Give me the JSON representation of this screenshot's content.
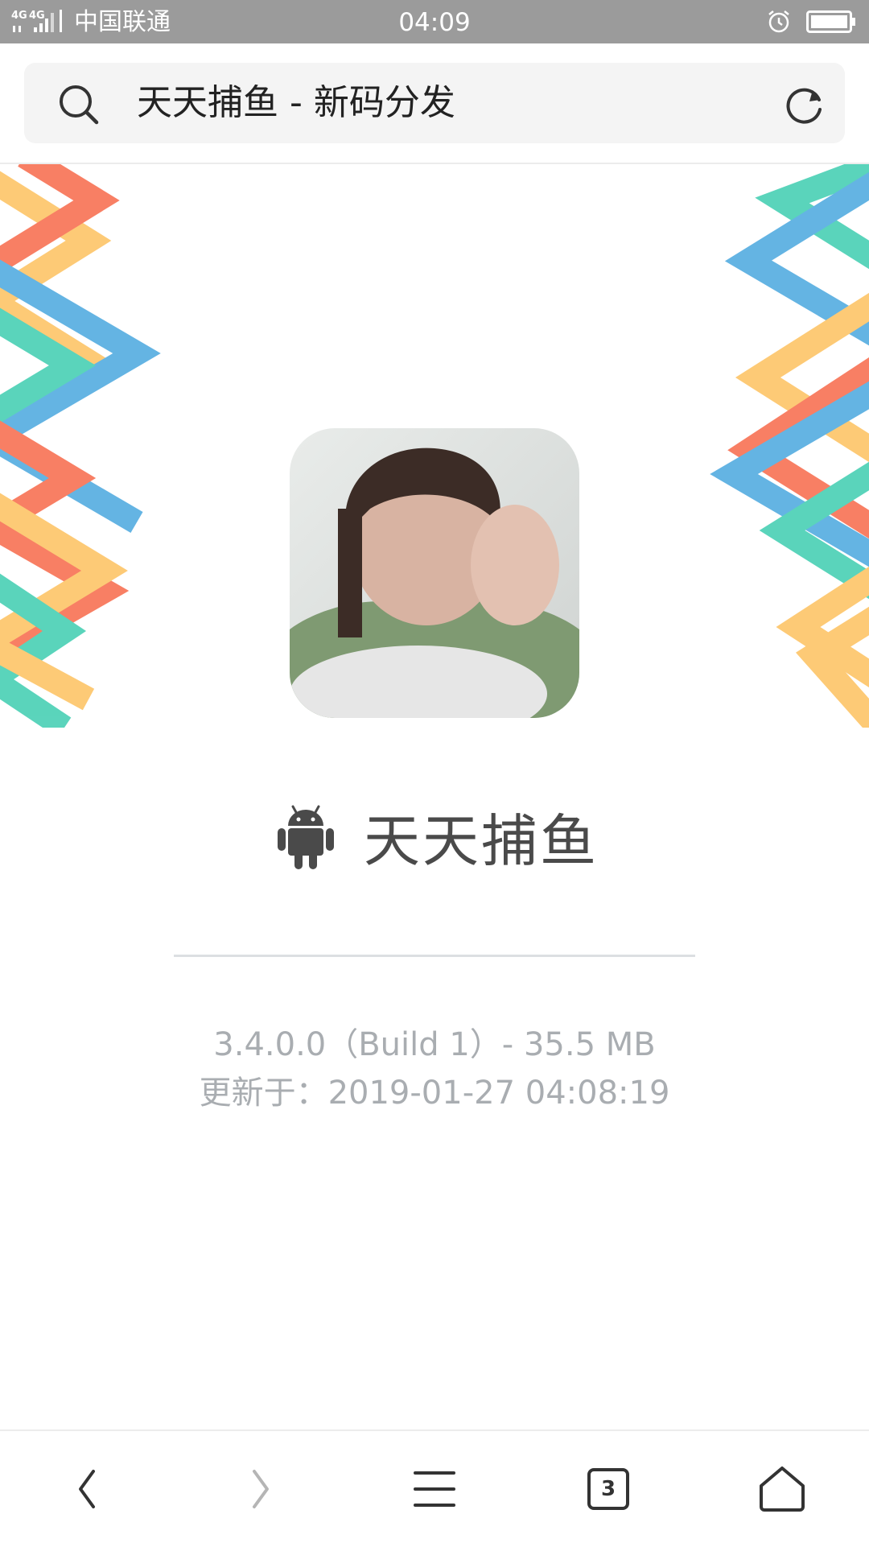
{
  "status_bar": {
    "network": "4G 4G",
    "carrier": "中国联通",
    "time": "04:09"
  },
  "address_bar": {
    "page_title": "天天捕鱼 - 新码分发"
  },
  "app": {
    "name": "天天捕鱼",
    "version_info": "3.4.0.0（Build 1）- 35.5 MB",
    "updated_info": "更新于：2019-01-27 04:08:19"
  },
  "bottom_bar": {
    "tab_count": "3"
  },
  "icons": [
    "search-icon",
    "refresh-icon",
    "android-icon",
    "back-icon",
    "forward-icon",
    "menu-icon",
    "tabs-icon",
    "home-icon",
    "alarm-icon",
    "battery-icon",
    "signal-icon"
  ],
  "colors": {
    "status_bar": "#9b9b9b",
    "pattern_red": "#f7694a",
    "pattern_yellow": "#fdc15f",
    "pattern_blue": "#4aa7df",
    "pattern_green": "#3ecdb0"
  }
}
